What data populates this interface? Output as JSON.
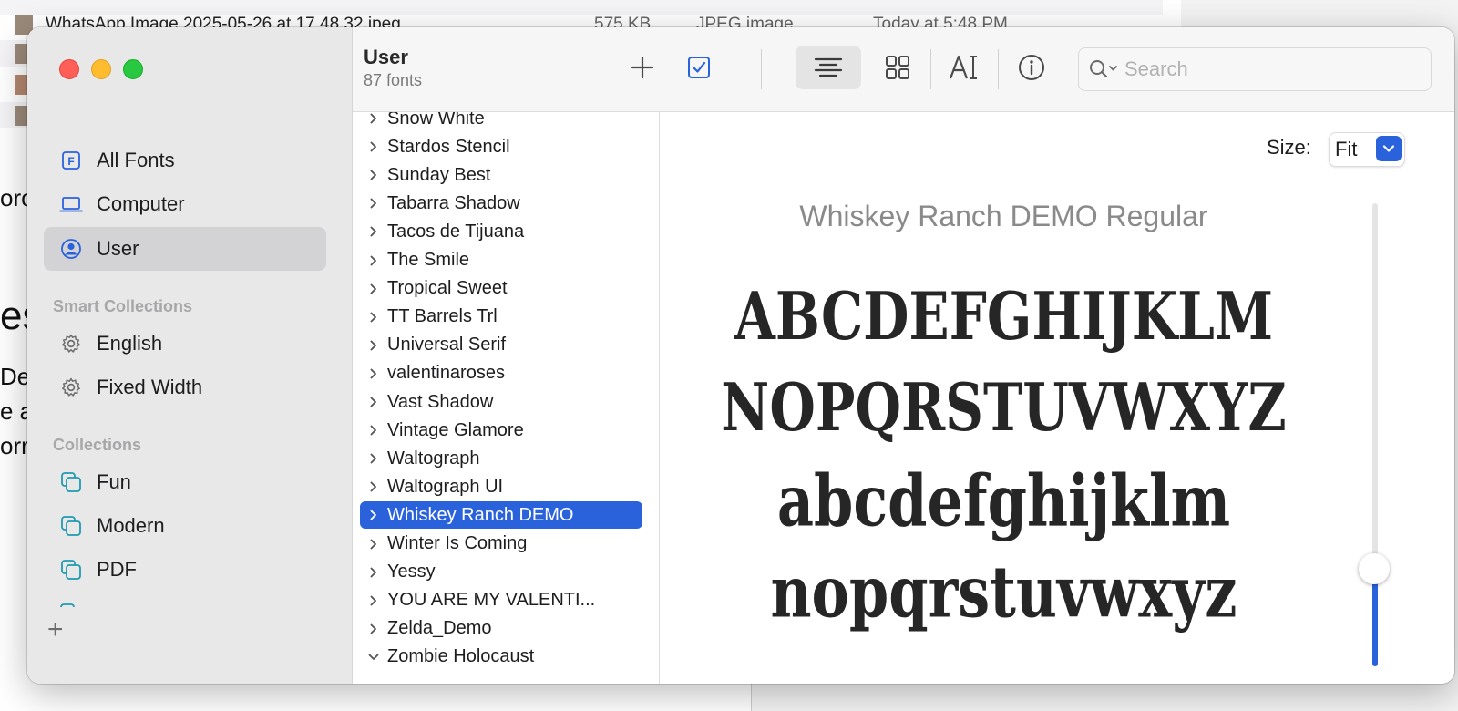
{
  "background": {
    "file_row": {
      "name": "WhatsApp Image 2025-05-26 at 17.48.32.jpeg",
      "size": "575 KB",
      "kind": "JPEG image",
      "date": "Today at 5:48 PM"
    },
    "doc_fragments": [
      "oro",
      "es",
      "De",
      "e a",
      "orr"
    ]
  },
  "window": {
    "sidebar": {
      "library": [
        {
          "label": "All Fonts",
          "icon": "all-fonts-icon"
        },
        {
          "label": "Computer",
          "icon": "laptop-icon"
        },
        {
          "label": "User",
          "icon": "user-icon"
        }
      ],
      "smart_heading": "Smart Collections",
      "smart": [
        {
          "label": "English",
          "icon": "gear-icon"
        },
        {
          "label": "Fixed Width",
          "icon": "gear-icon"
        }
      ],
      "collections_heading": "Collections",
      "collections": [
        {
          "label": "Fun",
          "icon": "collection-icon"
        },
        {
          "label": "Modern",
          "icon": "collection-icon"
        },
        {
          "label": "PDF",
          "icon": "collection-icon"
        }
      ],
      "add_label": "+"
    },
    "toolbar": {
      "title": "User",
      "subtitle": "87 fonts",
      "search_placeholder": "Search"
    },
    "font_list": [
      "Snow White",
      "Stardos Stencil",
      "Sunday Best",
      "Tabarra Shadow",
      "Tacos de Tijuana",
      "The Smile",
      "Tropical Sweet",
      "TT Barrels Trl",
      "Universal Serif",
      "valentinaroses",
      "Vast Shadow",
      "Vintage Glamore",
      "Waltograph",
      "Waltograph UI",
      "Whiskey Ranch DEMO",
      "Winter Is Coming",
      "Yessy",
      "YOU ARE MY VALENTI...",
      "Zelda_Demo",
      "Zombie Holocaust"
    ],
    "selected_font": "Whiskey Ranch DEMO",
    "preview": {
      "size_label": "Size:",
      "size_value": "Fit",
      "font_name": "Whiskey Ranch DEMO Regular",
      "lines": [
        "ABCDEFGHIJKLM",
        "NOPQRSTUVWXYZ",
        "abcdefghijklm",
        "nopqrstuvwxyz"
      ]
    },
    "colors": {
      "accent": "#2a62dc",
      "close": "#ff5f57",
      "minimize": "#febc2e",
      "maximize": "#28c840"
    }
  }
}
